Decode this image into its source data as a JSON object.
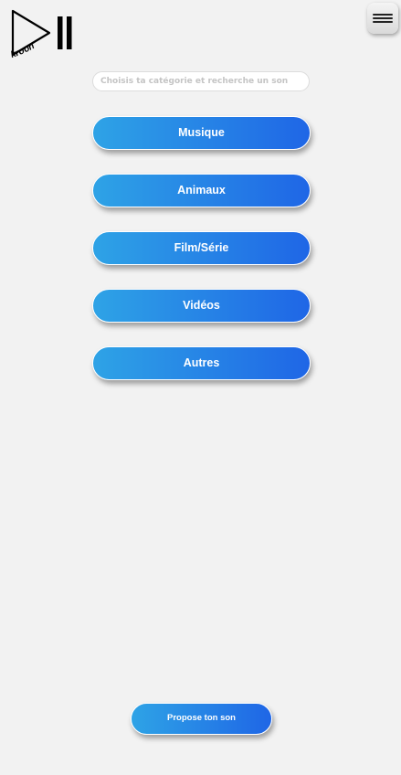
{
  "logo": {
    "text": "kroon",
    "icon": "play-pause-logo-icon"
  },
  "menu": {
    "icon": "hamburger-menu-icon"
  },
  "search": {
    "placeholder": "Choisis ta catégorie et recherche un son",
    "value": ""
  },
  "categories": [
    {
      "label": "Musique"
    },
    {
      "label": "Animaux"
    },
    {
      "label": "Film/Série"
    },
    {
      "label": "Vidéos"
    },
    {
      "label": "Autres"
    }
  ],
  "propose": {
    "label": "Propose ton son"
  },
  "colors": {
    "background": "#f2f2f2",
    "button_gradient_start": "#2ea3e6",
    "button_gradient_end": "#1f66e6",
    "button_text": "#ffffff"
  }
}
